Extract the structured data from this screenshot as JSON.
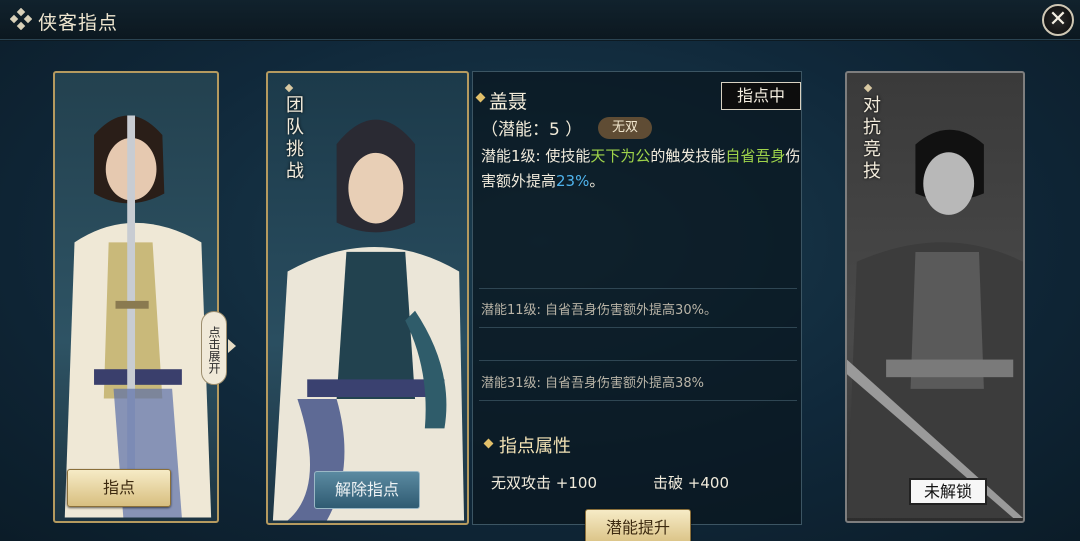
{
  "title": "侠客指点",
  "close_symbol": "✕",
  "left_card": {
    "button": "指点",
    "expand_label": "点击展开"
  },
  "mid_card": {
    "label": "团队挑战",
    "button": "解除指点"
  },
  "right_card": {
    "label": "对抗竞技",
    "button": "未解锁"
  },
  "panel": {
    "name": "盖聂",
    "status": "指点中",
    "potential": "（潜能：5 ）",
    "badge": "无双",
    "desc": {
      "p1": "潜能1级: 使技能",
      "s1": "天下为公",
      "p2": "的触发技能",
      "s2": "自省吾身",
      "p3": "伤害额外提高",
      "v1": "23%",
      "p4": "。"
    },
    "level11": "潜能11级: 自省吾身伤害额外提高30%。",
    "level31": "潜能31级: 自省吾身伤害额外提高38%",
    "attr_title": "指点属性",
    "attr1_name": "无双攻击",
    "attr1_value": "+100",
    "attr2_name": "击破",
    "attr2_value": "+400",
    "button": "潜能提升"
  },
  "colors": {
    "gold_border": "#b59a5f",
    "highlight_green": "#9fd44a",
    "highlight_blue": "#4fb3ec"
  },
  "icons": [
    "title-knot-icon",
    "close-icon",
    "expand-arrow-icon"
  ]
}
